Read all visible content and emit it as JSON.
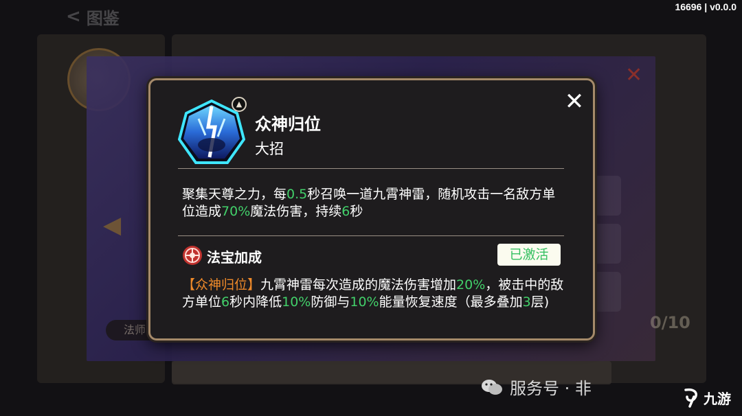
{
  "header": {
    "back_glyph": "<",
    "title": "图鉴"
  },
  "version": "16696 | v0.0.0",
  "background": {
    "tab_left_label": "法师",
    "counter": "0/10"
  },
  "modal": {
    "close_glyph": "✕",
    "skill_icon": "lightning-skill-icon",
    "level_glyph": "▲",
    "skill_name": "众神归位",
    "skill_type": "大招",
    "description": {
      "p1": "聚集天尊之力，每",
      "v1": "0.5",
      "p2": "秒召唤一道九霄神雷，随机攻击一名敌方单位造成",
      "v2": "70%",
      "p3": "魔法伤害，持续",
      "v3": "6",
      "p4": "秒"
    },
    "treasure": {
      "icon": "treasure-medallion-icon",
      "title": "法宝加成",
      "status": "已激活",
      "bonus": {
        "tag": "【众神归位】",
        "p1": "九霄神雷每次造成的魔法伤害增加",
        "v1": "20%",
        "p2": "，被击中的敌方单位",
        "v2": "6",
        "p3": "秒内降低",
        "v3": "10%",
        "p4": "防御与",
        "v4": "10%",
        "p5": "能量恢复速度（最多叠加",
        "v5": "3",
        "p6": "层)"
      }
    }
  },
  "colors": {
    "highlight_green": "#42d06a",
    "highlight_orange": "#ef8a2a",
    "modal_border": "#a58a6a",
    "modal_bg": "#1e1c1e"
  },
  "watermark": {
    "icon": "wechat-icon",
    "text": "服务号 · 非"
  },
  "logo": {
    "text": "九游"
  }
}
